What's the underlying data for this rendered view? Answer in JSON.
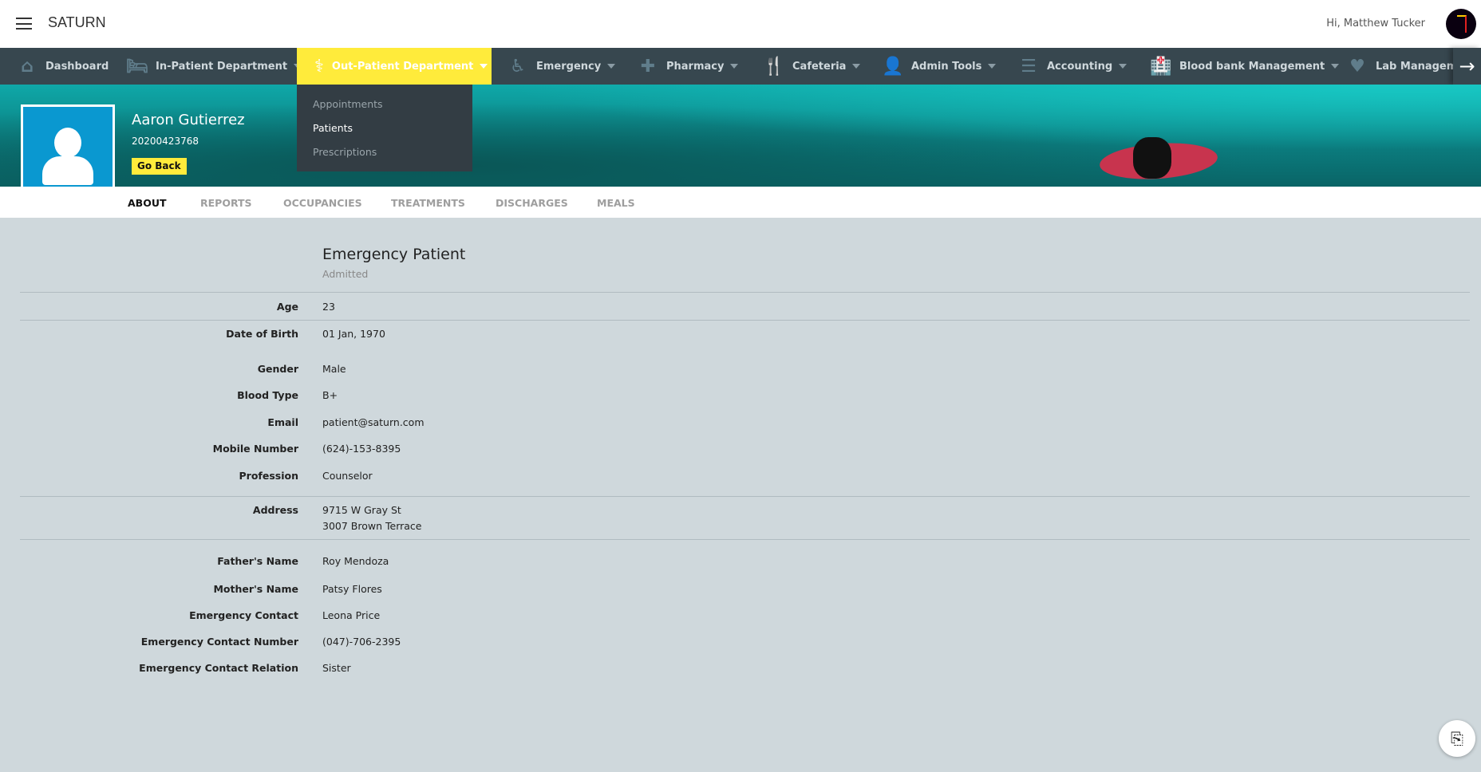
{
  "app": {
    "brand": "SATURN",
    "greeting": "Hi, Matthew Tucker"
  },
  "colors": {
    "accent": "#ffeb3b",
    "nav_bg": "#37474f",
    "avatar_bg": "#0a98d0",
    "page_bg": "#cfd8dc"
  },
  "nav": {
    "items": [
      {
        "label": "Dashboard",
        "icon": "home-icon"
      },
      {
        "label": "In-Patient Department",
        "icon": "bed-icon"
      },
      {
        "label": "Out-Patient Department",
        "icon": "stethoscope-icon",
        "active": true
      },
      {
        "label": "Emergency",
        "icon": "wheelchair-icon"
      },
      {
        "label": "Pharmacy",
        "icon": "medkit-icon"
      },
      {
        "label": "Cafeteria",
        "icon": "cutlery-icon"
      },
      {
        "label": "Admin Tools",
        "icon": "user-icon"
      },
      {
        "label": "Accounting",
        "icon": "list-ol-icon"
      },
      {
        "label": "Blood bank Management",
        "icon": "hospital-icon"
      },
      {
        "label": "Lab Management",
        "icon": "heartbeat-icon"
      }
    ],
    "dropdown": [
      "Appointments",
      "Patients",
      "Prescriptions"
    ]
  },
  "patient": {
    "name": "Aaron Gutierrez",
    "id": "20200423768",
    "go_back": "Go Back"
  },
  "tabs": [
    "ABOUT",
    "REPORTS",
    "OCCUPANCIES",
    "TREATMENTS",
    "DISCHARGES",
    "MEALS"
  ],
  "about": {
    "title": "Emergency Patient",
    "status": "Admitted",
    "age": {
      "label": "Age",
      "value": "23"
    },
    "dob": {
      "label": "Date of Birth",
      "value": "01 Jan, 1970"
    },
    "gender": {
      "label": "Gender",
      "value": "Male"
    },
    "blood": {
      "label": "Blood Type",
      "value": "B+"
    },
    "email": {
      "label": "Email",
      "value": "patient@saturn.com"
    },
    "mobile": {
      "label": "Mobile Number",
      "value": "(624)-153-8395"
    },
    "profession": {
      "label": "Profession",
      "value": "Counselor"
    },
    "address": {
      "label": "Address",
      "line1": "9715 W Gray St",
      "line2": "3007 Brown Terrace"
    },
    "father": {
      "label": "Father's Name",
      "value": "Roy Mendoza"
    },
    "mother": {
      "label": "Mother's Name",
      "value": "Patsy Flores"
    },
    "ec": {
      "label": "Emergency Contact",
      "value": "Leona Price"
    },
    "ecn": {
      "label": "Emergency Contact Number",
      "value": "(047)-706-2395"
    },
    "ecr": {
      "label": "Emergency Contact Relation",
      "value": "Sister"
    }
  }
}
